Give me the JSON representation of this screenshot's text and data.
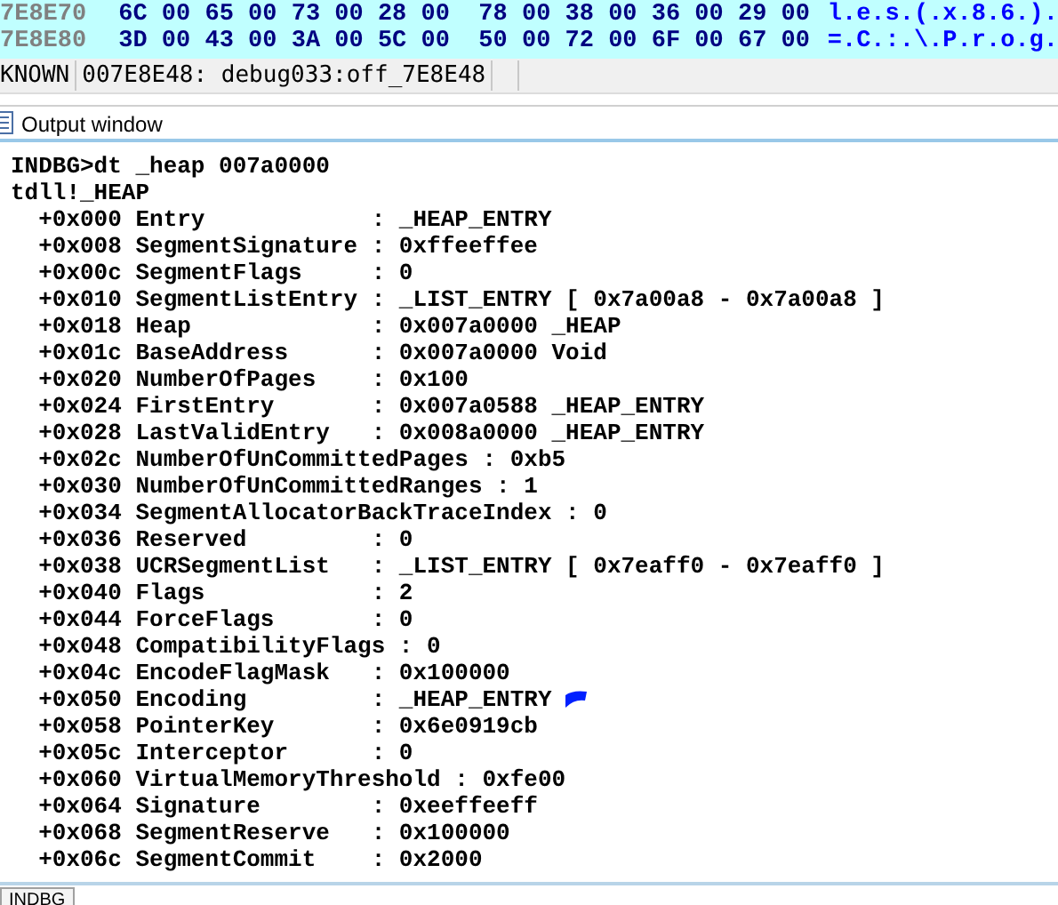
{
  "hex_view": {
    "rows": [
      {
        "address": "7E8E70",
        "bytes": "6C 00 65 00 73 00 28 00  78 00 38 00 36 00 29 00",
        "ascii": "l.e.s.(.x.8.6.)."
      },
      {
        "address": "7E8E80",
        "bytes": "3D 00 43 00 3A 00 5C 00  50 00 72 00 6F 00 67 00",
        "ascii": "=.C.:.\\.P.r.o.g."
      }
    ]
  },
  "status_bar": {
    "segment": "KNOWN",
    "location": "007E8E48: debug033:off_7E8E48"
  },
  "output_window": {
    "title": "Output window",
    "lines": [
      "INDBG>dt _heap 007a0000",
      "tdll!_HEAP",
      "  +0x000 Entry            : _HEAP_ENTRY",
      "  +0x008 SegmentSignature : 0xffeeffee",
      "  +0x00c SegmentFlags     : 0",
      "  +0x010 SegmentListEntry : _LIST_ENTRY [ 0x7a00a8 - 0x7a00a8 ]",
      "  +0x018 Heap             : 0x007a0000 _HEAP",
      "  +0x01c BaseAddress      : 0x007a0000 Void",
      "  +0x020 NumberOfPages    : 0x100",
      "  +0x024 FirstEntry       : 0x007a0588 _HEAP_ENTRY",
      "  +0x028 LastValidEntry   : 0x008a0000 _HEAP_ENTRY",
      "  +0x02c NumberOfUnCommittedPages : 0xb5",
      "  +0x030 NumberOfUnCommittedRanges : 1",
      "  +0x034 SegmentAllocatorBackTraceIndex : 0",
      "  +0x036 Reserved         : 0",
      "  +0x038 UCRSegmentList   : _LIST_ENTRY [ 0x7eaff0 - 0x7eaff0 ]",
      "  +0x040 Flags            : 2",
      "  +0x044 ForceFlags       : 0",
      "  +0x048 CompatibilityFlags : 0",
      "  +0x04c EncodeFlagMask   : 0x100000",
      "  +0x050 Encoding         : _HEAP_ENTRY",
      "  +0x058 PointerKey       : 0x6e0919cb",
      "  +0x05c Interceptor      : 0",
      "  +0x060 VirtualMemoryThreshold : 0xfe00",
      "  +0x064 Signature        : 0xeeffeeff",
      "  +0x068 SegmentReserve   : 0x100000",
      "  +0x06c SegmentCommit    : 0x2000"
    ]
  },
  "bottom_tab": {
    "label": "INDBG"
  }
}
